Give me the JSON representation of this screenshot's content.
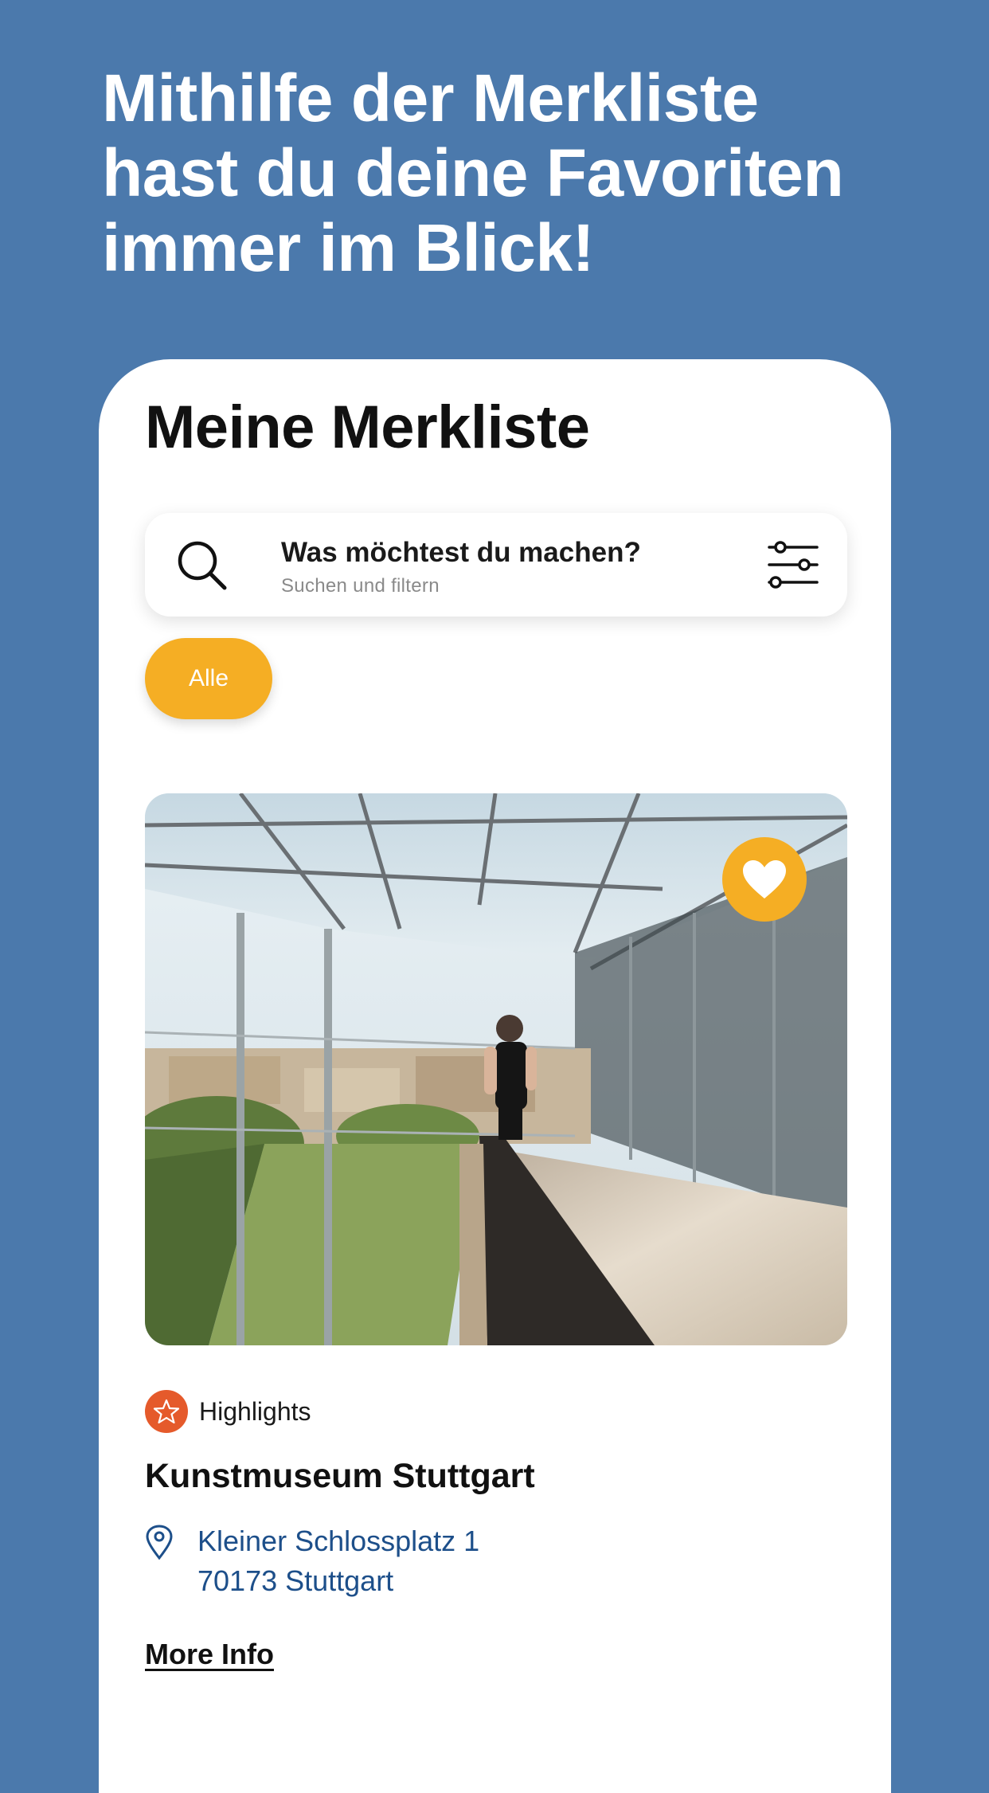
{
  "headline": {
    "line1": "Mithilfe der Merkliste",
    "line2": "hast du deine Favoriten",
    "line3": "immer im Blick!"
  },
  "screen": {
    "title": "Meine Merkliste",
    "search": {
      "title": "Was möchtest du machen?",
      "subtitle": "Suchen und filtern",
      "icon": "search-icon",
      "filter_icon": "sliders-icon"
    },
    "filter_chip": {
      "label": "Alle"
    },
    "card": {
      "image_alt": "",
      "favorite_icon": "heart-icon",
      "category": {
        "label": "Highlights",
        "icon": "star-icon"
      },
      "name": "Kunstmuseum Stuttgart",
      "address": {
        "icon": "location-pin-icon",
        "line1": "Kleiner Schlossplatz 1",
        "line2": "70173 Stuttgart"
      },
      "more_info": "More Info"
    }
  },
  "colors": {
    "background": "#4b79ac",
    "accent": "#f5ae24",
    "category": "#e55a2b",
    "link": "#1d4f8a"
  }
}
